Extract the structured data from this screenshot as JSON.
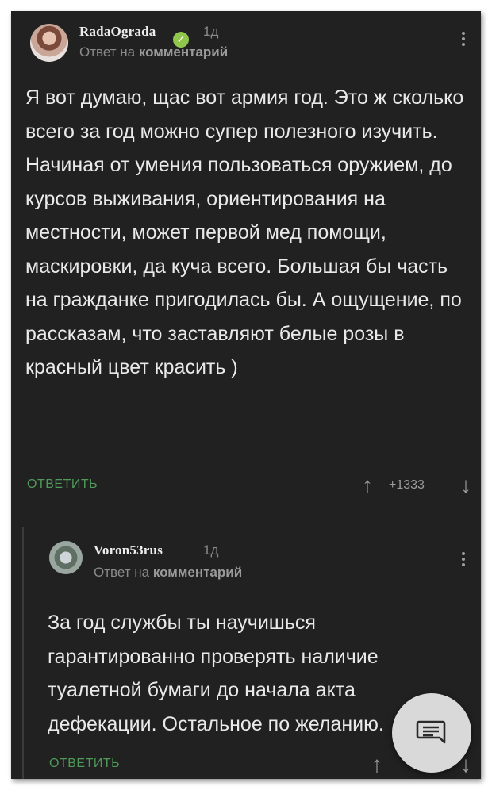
{
  "comment1": {
    "username": "RadaOgrada",
    "time": "1д",
    "reply_prefix": "Ответ на",
    "reply_target": "комментарий",
    "text": "Я вот думаю, щас вот армия год. Это ж сколько всего за год можно супер полезного изучить. Начиная от умения пользоваться оружием, до курсов выживания, ориентирования на местности, может первой мед помощи, маскировки, да куча всего. Большая бы часть на гражданке пригодилась бы. А ощущение, по рассказам, что заставляют белые розы в красный цвет красить )",
    "reply_label": "ОТВЕТИТЬ",
    "rating": "+1333",
    "upvote_icon": "↑",
    "downvote_icon": "↓"
  },
  "comment2": {
    "username": "Voron53rus",
    "time": "1д",
    "reply_prefix": "Ответ на",
    "reply_target": "комментарий",
    "text": "За год службы ты научишься гарантированно проверять наличие туалетной бумаги до начала акта дефекации. Остальное по желанию.",
    "reply_label": "ОТВЕТИТЬ",
    "upvote_icon": "↑",
    "downvote_icon": "↓"
  },
  "fab": {
    "icon": "chat-bubble-icon"
  },
  "colors": {
    "background": "#212121",
    "accent_green": "#4f9a58",
    "verified": "#8fc64b"
  }
}
